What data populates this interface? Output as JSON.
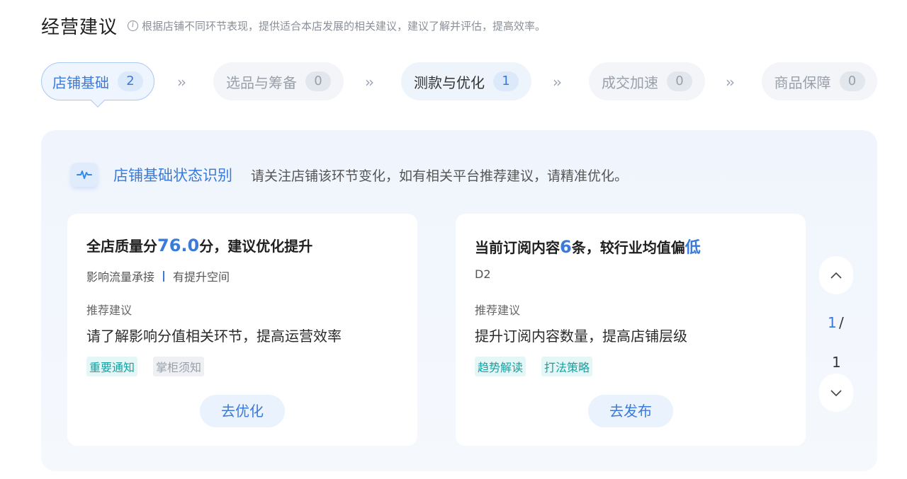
{
  "header": {
    "title": "经营建议",
    "hint": "根据店铺不同环节表现，提供适合本店发展的相关建议，建议了解并评估，提高效率。"
  },
  "steps": [
    {
      "label": "店铺基础",
      "count": "2"
    },
    {
      "label": "选品与筹备",
      "count": "0"
    },
    {
      "label": "测款与优化",
      "count": "1"
    },
    {
      "label": "成交加速",
      "count": "0"
    },
    {
      "label": "商品保障",
      "count": "0"
    }
  ],
  "step_arrow": "››",
  "section": {
    "title": "店铺基础状态识别",
    "desc": "请关注店铺该环节变化，如有相关平台推荐建议，请精准优化。"
  },
  "cards": [
    {
      "title_pre": "全店质量分",
      "title_hl": "76.0",
      "title_post": "分，建议优化提升",
      "sub1": "影响流量承接",
      "sub2": "有提升空间",
      "rec_label": "推荐建议",
      "rec_text": "请了解影响分值相关环节，提高运营效率",
      "tags": [
        "重要通知",
        "掌柜须知"
      ],
      "button": "去优化"
    },
    {
      "title_pre": "当前订阅内容",
      "title_hl": "6",
      "title_post": "条，较行业均值偏",
      "title_hl2": "低",
      "sub1": "D2",
      "rec_label": "推荐建议",
      "rec_text": "提升订阅内容数量，提高店铺层级",
      "tags": [
        "趋势解读",
        "打法策略"
      ],
      "button": "去发布"
    }
  ],
  "pager": {
    "current": "1",
    "separator": "/",
    "total": "1"
  },
  "colors": {
    "accent": "#3a7ad8",
    "tag_teal": "#18a0a0",
    "panel_bg": "#f0f5fd"
  }
}
